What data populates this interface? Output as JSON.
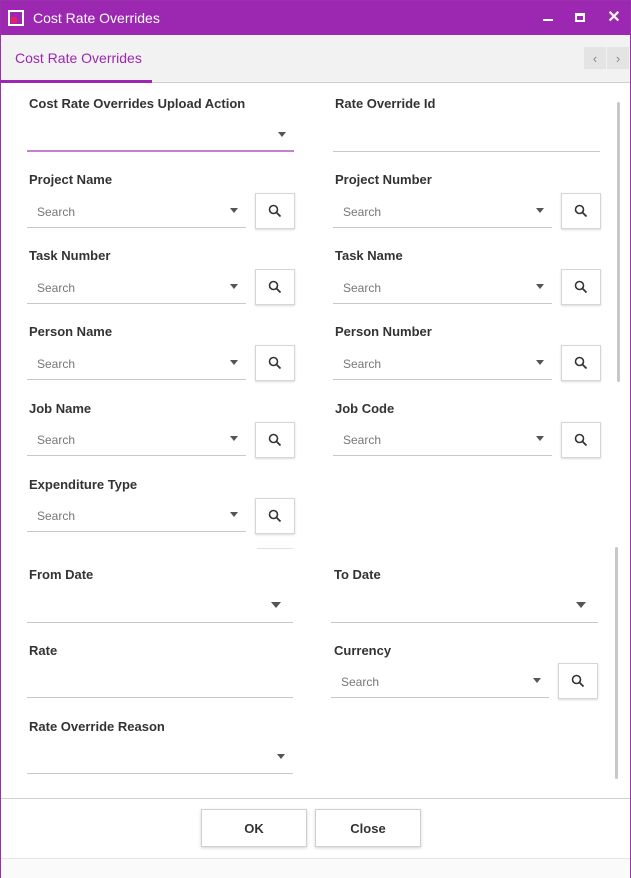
{
  "window": {
    "title": "Cost Rate Overrides"
  },
  "tabs": [
    {
      "label": "Cost Rate Overrides"
    }
  ],
  "form": {
    "upload_action_label": "Cost Rate Overrides Upload Action",
    "rate_override_id_label": "Rate Override Id",
    "project_name_label": "Project Name",
    "project_number_label": "Project Number",
    "task_number_label": "Task Number",
    "task_name_label": "Task Name",
    "person_name_label": "Person Name",
    "person_number_label": "Person Number",
    "job_name_label": "Job Name",
    "job_code_label": "Job Code",
    "expenditure_type_label": "Expenditure Type",
    "from_date_label": "From Date",
    "to_date_label": "To Date",
    "rate_label": "Rate",
    "currency_label": "Currency",
    "rate_override_reason_label": "Rate Override Reason",
    "search_placeholder": "Search"
  },
  "footer": {
    "ok_label": "OK",
    "close_label": "Close"
  },
  "colors": {
    "accent": "#9c27b0",
    "focus_underline": "#c77fd4"
  }
}
